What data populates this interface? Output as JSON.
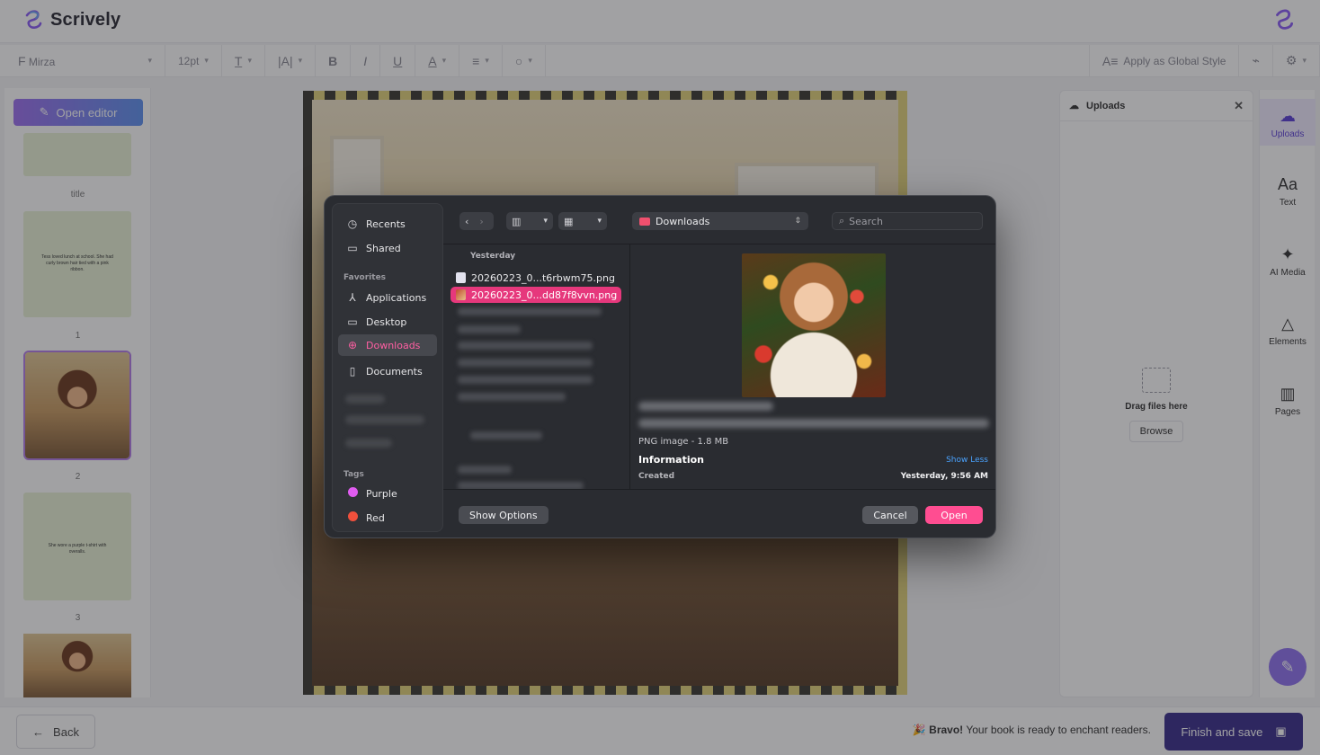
{
  "app": {
    "name": "Scrively",
    "brand_color": "#8b5cf6"
  },
  "toolbar": {
    "font": "Mirza",
    "size": "12pt",
    "apply_global": "Apply as Global Style"
  },
  "left_panel": {
    "open_editor": "Open editor",
    "pages": [
      {
        "label": "title"
      },
      {
        "label": "1",
        "text": "Tess loved lunch at school. She had curly brown hair tied with a pink ribbon."
      },
      {
        "label": "2"
      },
      {
        "label": "3",
        "text": "She wore a purple t-shirt with overalls."
      }
    ]
  },
  "uploads": {
    "title": "Uploads",
    "drag_text": "Drag files here",
    "browse": "Browse"
  },
  "rail": {
    "items": [
      {
        "label": "Uploads",
        "icon": "cloud-upload-icon"
      },
      {
        "label": "Text",
        "icon": "text-icon"
      },
      {
        "label": "AI Media",
        "icon": "sparkle-icon"
      },
      {
        "label": "Elements",
        "icon": "shapes-icon"
      },
      {
        "label": "Pages",
        "icon": "book-icon"
      }
    ]
  },
  "bottom": {
    "back": "Back",
    "bravo_bold": "Bravo!",
    "bravo_rest": "Your book is ready to enchant readers.",
    "finish": "Finish and save"
  },
  "dialog": {
    "sidebar": {
      "recents": "Recents",
      "shared": "Shared",
      "favorites_heading": "Favorites",
      "applications": "Applications",
      "desktop": "Desktop",
      "downloads": "Downloads",
      "documents": "Documents",
      "tags_heading": "Tags",
      "tags": [
        {
          "name": "Purple",
          "color": "#e05cf0"
        },
        {
          "name": "Red",
          "color": "#f0503c"
        }
      ]
    },
    "location": "Downloads",
    "search_placeholder": "Search",
    "column_heading": "Yesterday",
    "files": [
      {
        "name": "20260223_0...t6rbwm75.png",
        "selected": false
      },
      {
        "name": "20260223_0...dd87f8vvn.png",
        "selected": true
      }
    ],
    "preview": {
      "kind": "PNG image - 1.8 MB",
      "info_heading": "Information",
      "show_less": "Show Less",
      "created_label": "Created",
      "created_value": "Yesterday, 9:56 AM"
    },
    "show_options": "Show Options",
    "cancel": "Cancel",
    "open": "Open",
    "accent_color": "#ff4d91"
  }
}
